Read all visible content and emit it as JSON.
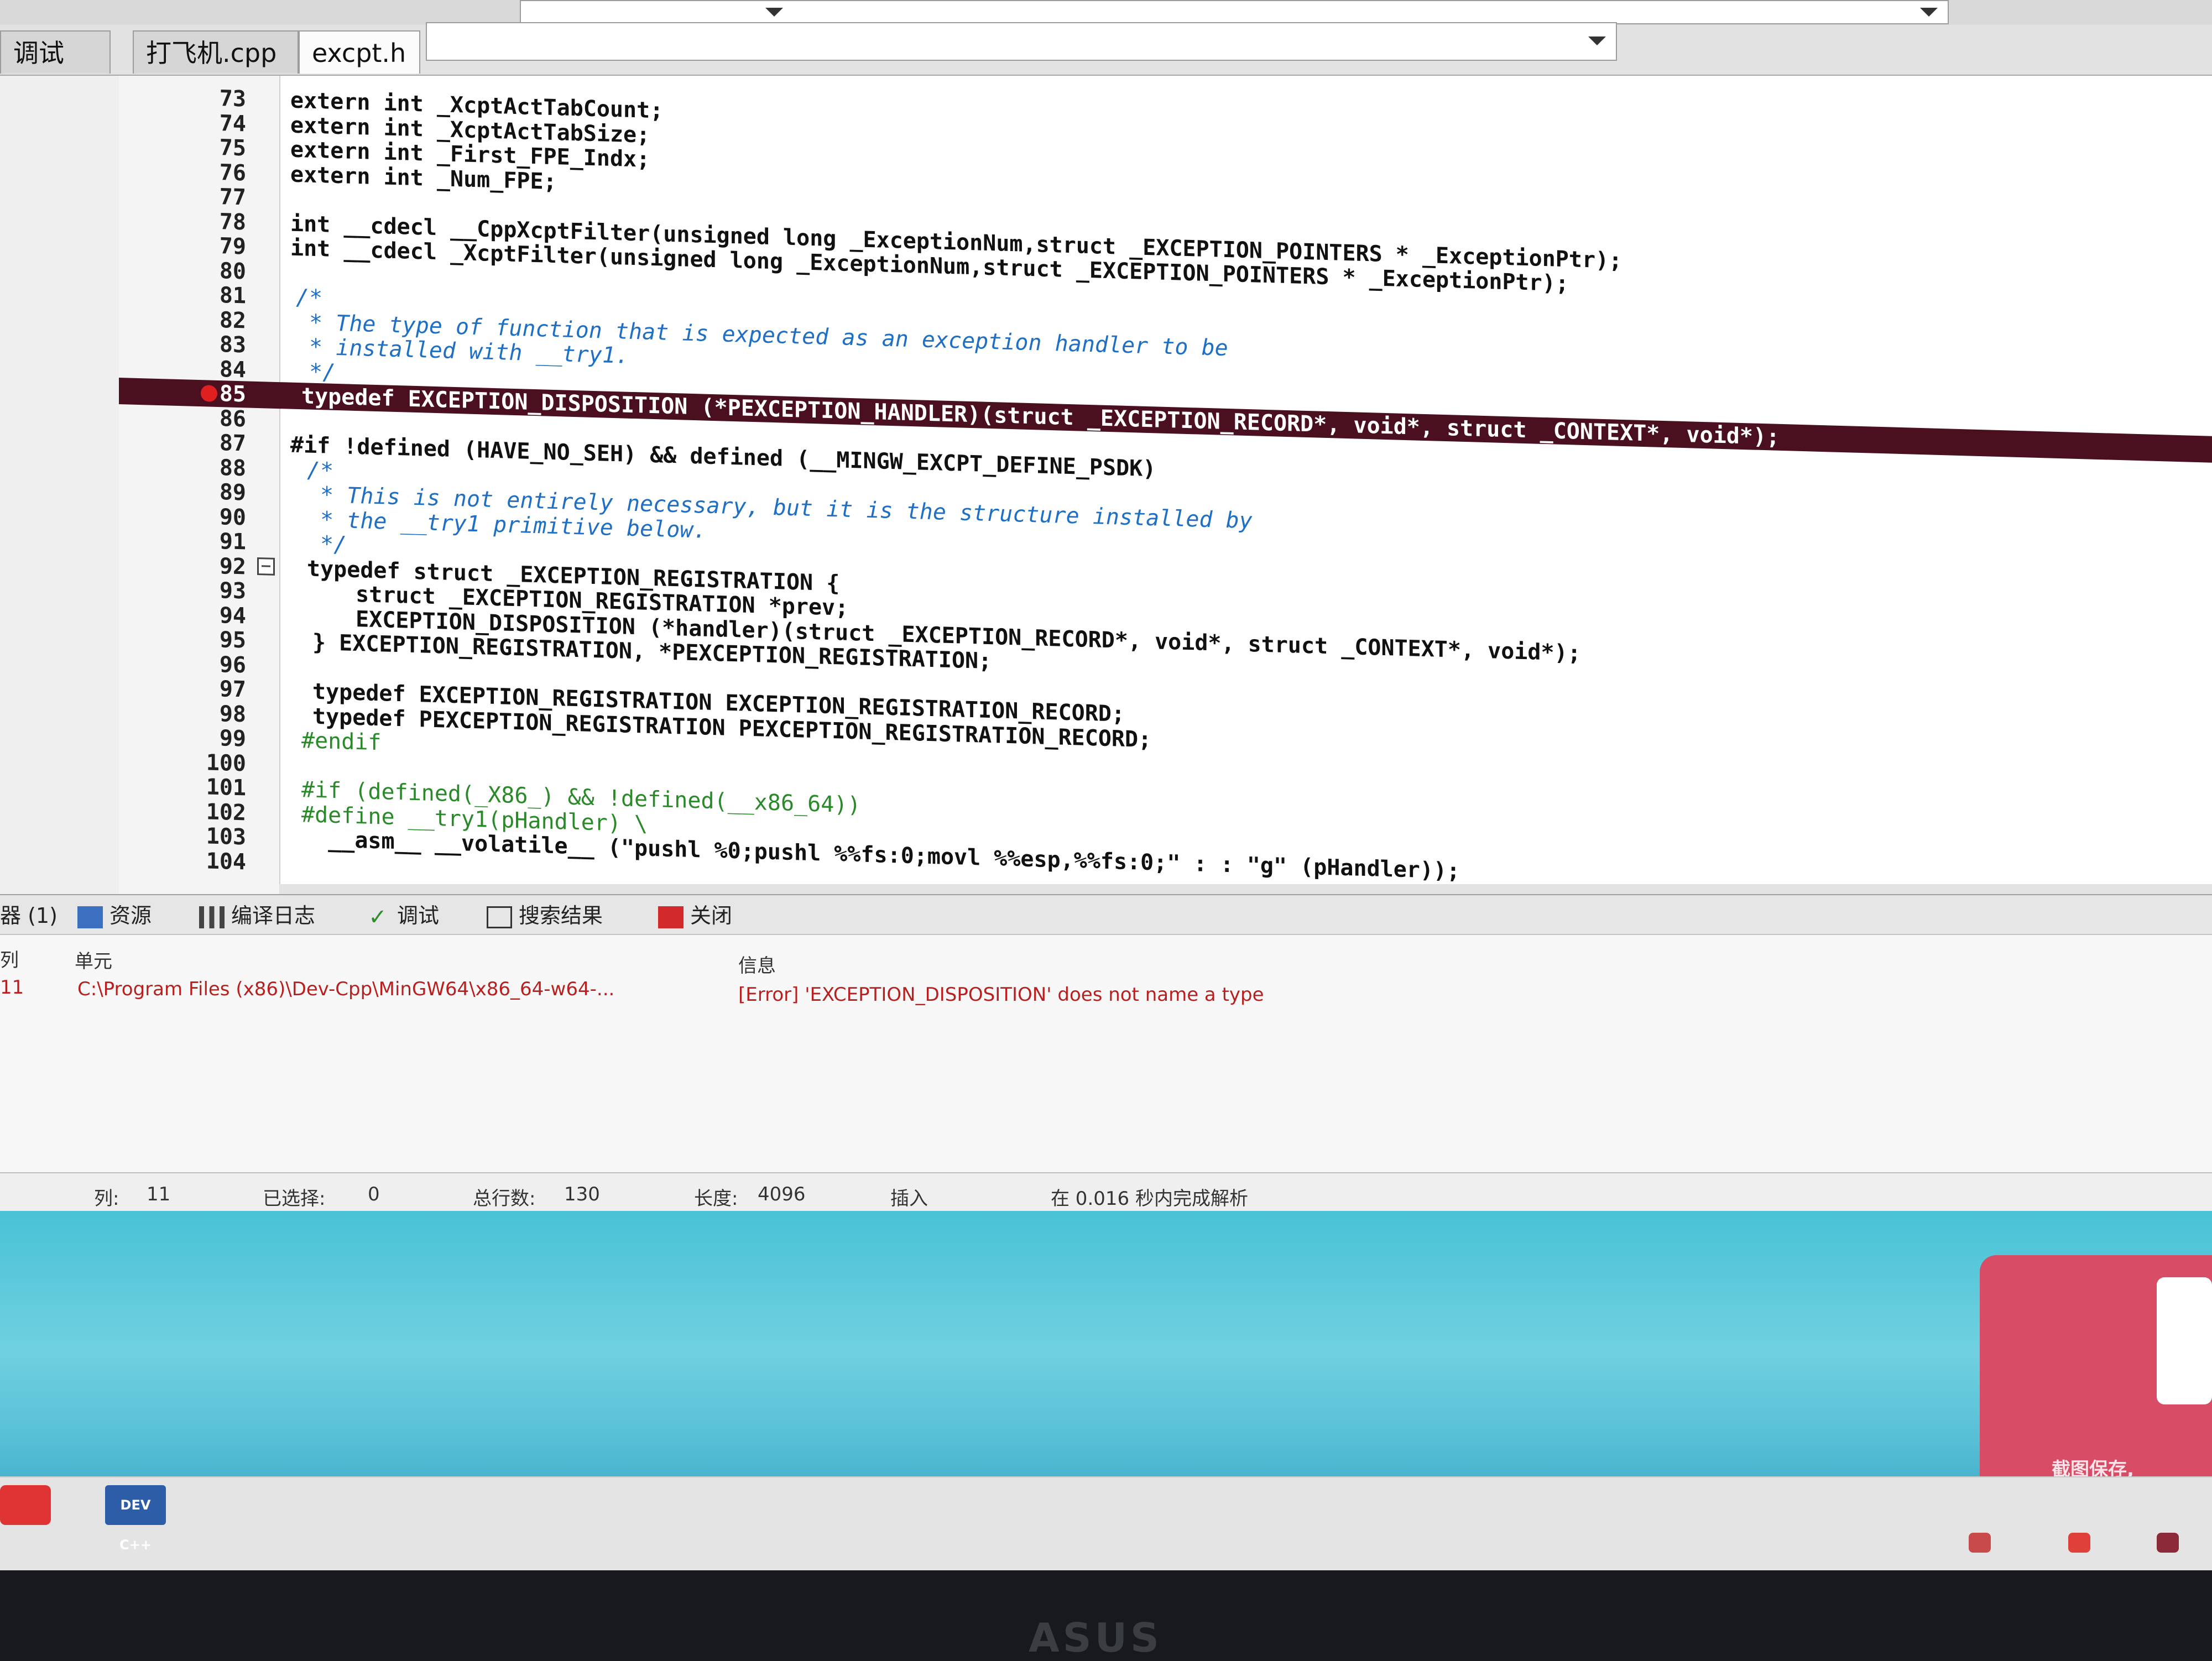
{
  "header": {
    "title_partial": ""
  },
  "tabs": {
    "left": "调试",
    "file1": "打飞机.cpp",
    "file2": "excpt.h"
  },
  "code": [
    {
      "n": "73",
      "t": "extern int _XcptActTabCount;"
    },
    {
      "n": "74",
      "t": "extern int _XcptActTabSize;"
    },
    {
      "n": "75",
      "t": "extern int _First_FPE_Indx;"
    },
    {
      "n": "76",
      "t": "extern int _Num_FPE;"
    },
    {
      "n": "77",
      "t": ""
    },
    {
      "n": "78",
      "t": "int __cdecl __CppXcptFilter(unsigned long _ExceptionNum,struct _EXCEPTION_POINTERS * _ExceptionPtr);"
    },
    {
      "n": "79",
      "t": "int __cdecl _XcptFilter(unsigned long _ExceptionNum,struct _EXCEPTION_POINTERS * _ExceptionPtr);"
    },
    {
      "n": "80",
      "t": ""
    },
    {
      "n": "81",
      "t": "/*"
    },
    {
      "n": "82",
      "t": " * The type of function that is expected as an exception handler to be"
    },
    {
      "n": "83",
      "t": " * installed with __try1."
    },
    {
      "n": "84",
      "t": " */"
    },
    {
      "n": "85",
      "t": "typedef EXCEPTION_DISPOSITION (*PEXCEPTION_HANDLER)(struct _EXCEPTION_RECORD*, void*, struct _CONTEXT*, void*);"
    },
    {
      "n": "86",
      "t": ""
    },
    {
      "n": "87",
      "t": "#if !defined (HAVE_NO_SEH) && defined (__MINGW_EXCPT_DEFINE_PSDK)"
    },
    {
      "n": "88",
      "t": "/*"
    },
    {
      "n": "89",
      "t": " * This is not entirely necessary, but it is the structure installed by"
    },
    {
      "n": "90",
      "t": " * the __try1 primitive below."
    },
    {
      "n": "91",
      "t": " */"
    },
    {
      "n": "92",
      "t": "typedef struct _EXCEPTION_REGISTRATION {"
    },
    {
      "n": "93",
      "t": "  struct _EXCEPTION_REGISTRATION *prev;"
    },
    {
      "n": "94",
      "t": "  EXCEPTION_DISPOSITION (*handler)(struct _EXCEPTION_RECORD*, void*, struct _CONTEXT*, void*);"
    },
    {
      "n": "95",
      "t": "} EXCEPTION_REGISTRATION, *PEXCEPTION_REGISTRATION;"
    },
    {
      "n": "96",
      "t": ""
    },
    {
      "n": "97",
      "t": "typedef EXCEPTION_REGISTRATION EXCEPTION_REGISTRATION_RECORD;"
    },
    {
      "n": "98",
      "t": "typedef PEXCEPTION_REGISTRATION PEXCEPTION_REGISTRATION_RECORD;"
    },
    {
      "n": "99",
      "t": "#endif"
    },
    {
      "n": "100",
      "t": ""
    },
    {
      "n": "101",
      "t": "#if (defined(_X86_) && !defined(__x86_64))"
    },
    {
      "n": "102",
      "t": "#define __try1(pHandler) \\"
    },
    {
      "n": "103",
      "t": "  __asm__ __volatile__ (\"pushl %0;pushl %%fs:0;movl %%esp,%%fs:0;\" : : \"g\" (pHandler));"
    },
    {
      "n": "104",
      "t": ""
    }
  ],
  "panel": {
    "tabs": [
      "器 (1)",
      "资源",
      "编译日志",
      "调试",
      "搜索结果",
      "关闭"
    ],
    "col_line": "列",
    "col_unit": "单元",
    "col_info": "信息",
    "msg_line": "11",
    "msg_file": "C:\\Program Files (x86)\\Dev-Cpp\\MinGW64\\x86_64-w64-...",
    "msg_text": "[Error] 'EXCEPTION_DISPOSITION' does not name a type"
  },
  "statusbar": {
    "col_label": "列:",
    "col_value": "11",
    "sel_label": "已选择:",
    "sel_value": "0",
    "total_label": "总行数:",
    "total_value": "130",
    "len_label": "长度:",
    "len_value": "4096",
    "mode": "插入",
    "parse": "在 0.016 秒内完成解析"
  },
  "desktop": {
    "widget_text": "截图保存,"
  },
  "taskbar": {
    "devcpp_label": "DEV C++"
  },
  "bezel": {
    "brand": "ASUS"
  },
  "colors": {
    "error_line_bg": "#4a1020",
    "comment": "#1f6fc4",
    "preprocessor": "#2a8a2a",
    "error_text": "#b82020"
  }
}
